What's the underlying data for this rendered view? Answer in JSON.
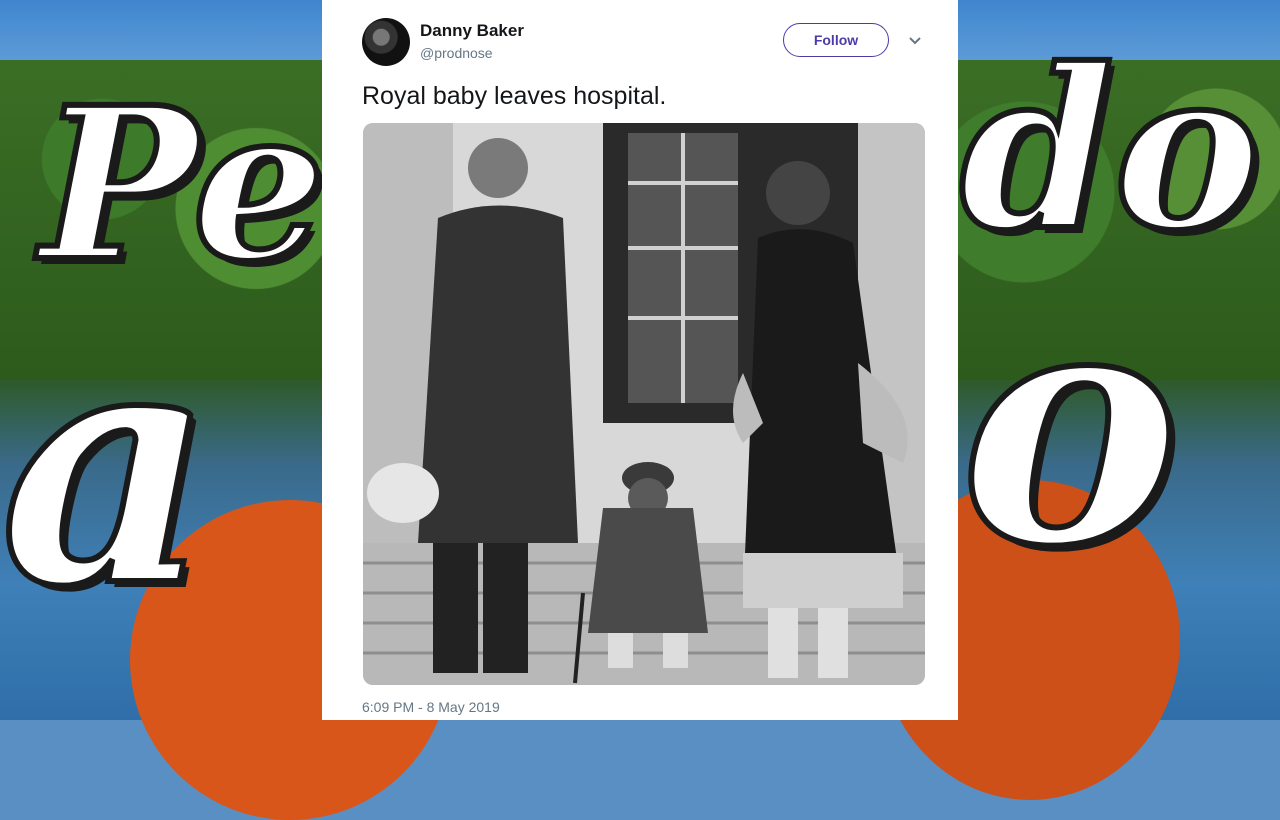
{
  "tweet": {
    "author_name": "Danny Baker",
    "author_handle": "@prodnose",
    "follow_label": "Follow",
    "text": "Royal baby leaves hospital.",
    "timestamp": "6:09 PM - 8 May 2019"
  },
  "overlay": {
    "letters": [
      "Pe",
      "a",
      "do",
      "o"
    ]
  },
  "icons": {
    "menu": "chevron-down-icon",
    "avatar": "avatar"
  },
  "colors": {
    "accent": "#4b3ca8",
    "text": "#14171a",
    "secondary": "#657786"
  }
}
